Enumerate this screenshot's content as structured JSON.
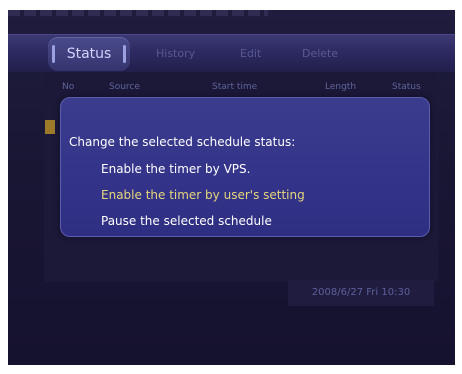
{
  "tabs": [
    {
      "label": "Status",
      "active": true
    },
    {
      "label": "History",
      "active": false
    },
    {
      "label": "Edit",
      "active": false
    },
    {
      "label": "Delete",
      "active": false
    }
  ],
  "table": {
    "columns": [
      "No",
      "Source",
      "Start time",
      "Length",
      "Status"
    ]
  },
  "dialog": {
    "title": "Change the selected schedule status:",
    "options": [
      {
        "label": "Enable the timer by VPS.",
        "selected": false
      },
      {
        "label": "Enable the timer by user's setting",
        "selected": true
      },
      {
        "label": "Pause the selected schedule",
        "selected": false
      }
    ]
  },
  "datetime": "2008/6/27 Fri 10:30",
  "colors": {
    "background": "#1d1a3a",
    "dialog": "#3b3c8d",
    "selected_option": "#e6d77a",
    "text": "#ffffff"
  }
}
